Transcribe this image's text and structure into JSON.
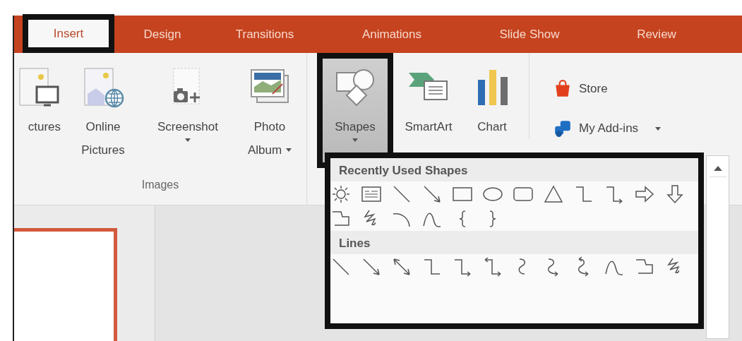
{
  "tabs": [
    {
      "label": "Insert",
      "selected": true,
      "highlighted": true
    },
    {
      "label": "Design",
      "selected": false,
      "highlighted": false
    },
    {
      "label": "Transitions",
      "selected": false,
      "highlighted": false
    },
    {
      "label": "Animations",
      "selected": false,
      "highlighted": false
    },
    {
      "label": "Slide Show",
      "selected": false,
      "highlighted": false
    },
    {
      "label": "Review",
      "selected": false,
      "highlighted": false
    }
  ],
  "images_group": {
    "label": "Images",
    "buttons": [
      {
        "kind": "pictures",
        "lines": [
          "ctures"
        ],
        "dropdown": false
      },
      {
        "kind": "online-pictures",
        "lines": [
          "Online",
          "Pictures"
        ],
        "dropdown": false
      },
      {
        "kind": "screenshot",
        "lines": [
          "Screenshot"
        ],
        "dropdown": true
      },
      {
        "kind": "photo-album",
        "lines": [
          "Photo",
          "Album"
        ],
        "dropdown": true
      }
    ]
  },
  "illustrations": [
    {
      "kind": "shapes",
      "lines": [
        "Shapes"
      ],
      "dropdown": true,
      "pressed": true,
      "highlighted": true
    },
    {
      "kind": "smartart",
      "lines": [
        "SmartArt"
      ],
      "dropdown": false,
      "pressed": false,
      "highlighted": false
    },
    {
      "kind": "chart",
      "lines": [
        "Chart"
      ],
      "dropdown": false,
      "pressed": false,
      "highlighted": false
    }
  ],
  "addins": [
    {
      "kind": "store",
      "label": "Store",
      "dropdown": false
    },
    {
      "kind": "my-addins",
      "label": "My Add-ins",
      "dropdown": true
    }
  ],
  "gallery": {
    "highlighted": true,
    "sections": [
      {
        "kind": "recent",
        "title": "Recently Used Shapes"
      },
      {
        "kind": "lines",
        "title": "Lines"
      }
    ]
  }
}
